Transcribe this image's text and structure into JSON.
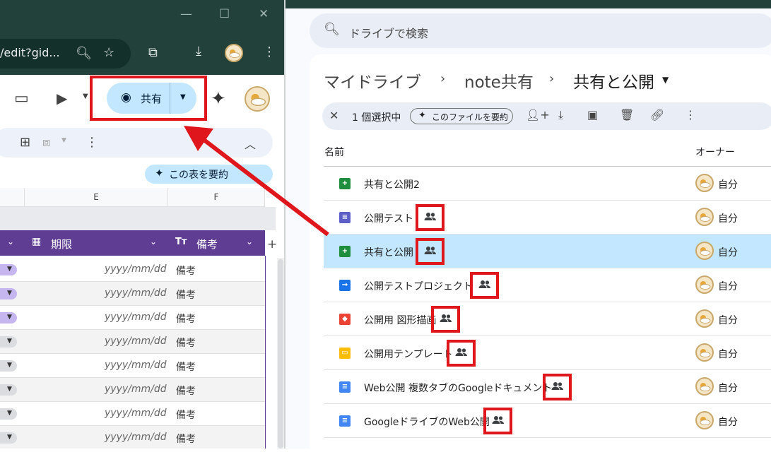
{
  "left_window": {
    "url_fragment": "/edit?gid...",
    "share_label": "共有",
    "summarize_label": "この表を要約",
    "columns": [
      "E",
      "F"
    ],
    "table_headers": {
      "deadline": "期限",
      "notes": "備考"
    },
    "rows": [
      {
        "date": "yyyy/mm/dd",
        "note": "備考",
        "chip": "#c5b6f0"
      },
      {
        "date": "yyyy/mm/dd",
        "note": "備考",
        "chip": "#c5b6f0"
      },
      {
        "date": "yyyy/mm/dd",
        "note": "備考",
        "chip": "#c5b6f0"
      },
      {
        "date": "yyyy/mm/dd",
        "note": "備考",
        "chip": "#dadce0"
      },
      {
        "date": "yyyy/mm/dd",
        "note": "備考",
        "chip": "#dadce0"
      },
      {
        "date": "yyyy/mm/dd",
        "note": "備考",
        "chip": "#dadce0"
      },
      {
        "date": "yyyy/mm/dd",
        "note": "備考",
        "chip": "#dadce0"
      },
      {
        "date": "yyyy/mm/dd",
        "note": "備考",
        "chip": "#dadce0"
      }
    ]
  },
  "drive": {
    "search_placeholder": "ドライブで検索",
    "breadcrumb": [
      "マイドライブ",
      "note共有",
      "共有と公開"
    ],
    "selection_text": "1 個選択中",
    "summarize_file_label": "このファイルを要約",
    "col_name": "名前",
    "col_owner": "オーナー",
    "files": [
      {
        "name": "共有と公開2",
        "type": "sheets",
        "color": "#1e8e3e",
        "shared": false,
        "owner": "自分"
      },
      {
        "name": "公開テスト",
        "type": "forms",
        "color": "#5b5fc7",
        "shared": true,
        "owner": "自分"
      },
      {
        "name": "共有と公開",
        "type": "sheets",
        "color": "#1e8e3e",
        "shared": true,
        "owner": "自分"
      },
      {
        "name": "公開テストプロジェクト",
        "type": "apps-script",
        "color": "#1a73e8",
        "shared": true,
        "owner": "自分"
      },
      {
        "name": "公開用 図形描画",
        "type": "drawings",
        "color": "#ea4335",
        "shared": true,
        "owner": "自分"
      },
      {
        "name": "公開用テンプレート",
        "type": "slides",
        "color": "#fbbc04",
        "shared": true,
        "owner": "自分"
      },
      {
        "name": "Web公開 複数タブのGoogleドキュメント",
        "type": "docs",
        "color": "#4285f4",
        "shared": true,
        "owner": "自分"
      },
      {
        "name": "GoogleドライブのWeb公開",
        "type": "docs",
        "color": "#4285f4",
        "shared": true,
        "owner": "自分"
      }
    ]
  },
  "annotation_color": "#e0161d"
}
